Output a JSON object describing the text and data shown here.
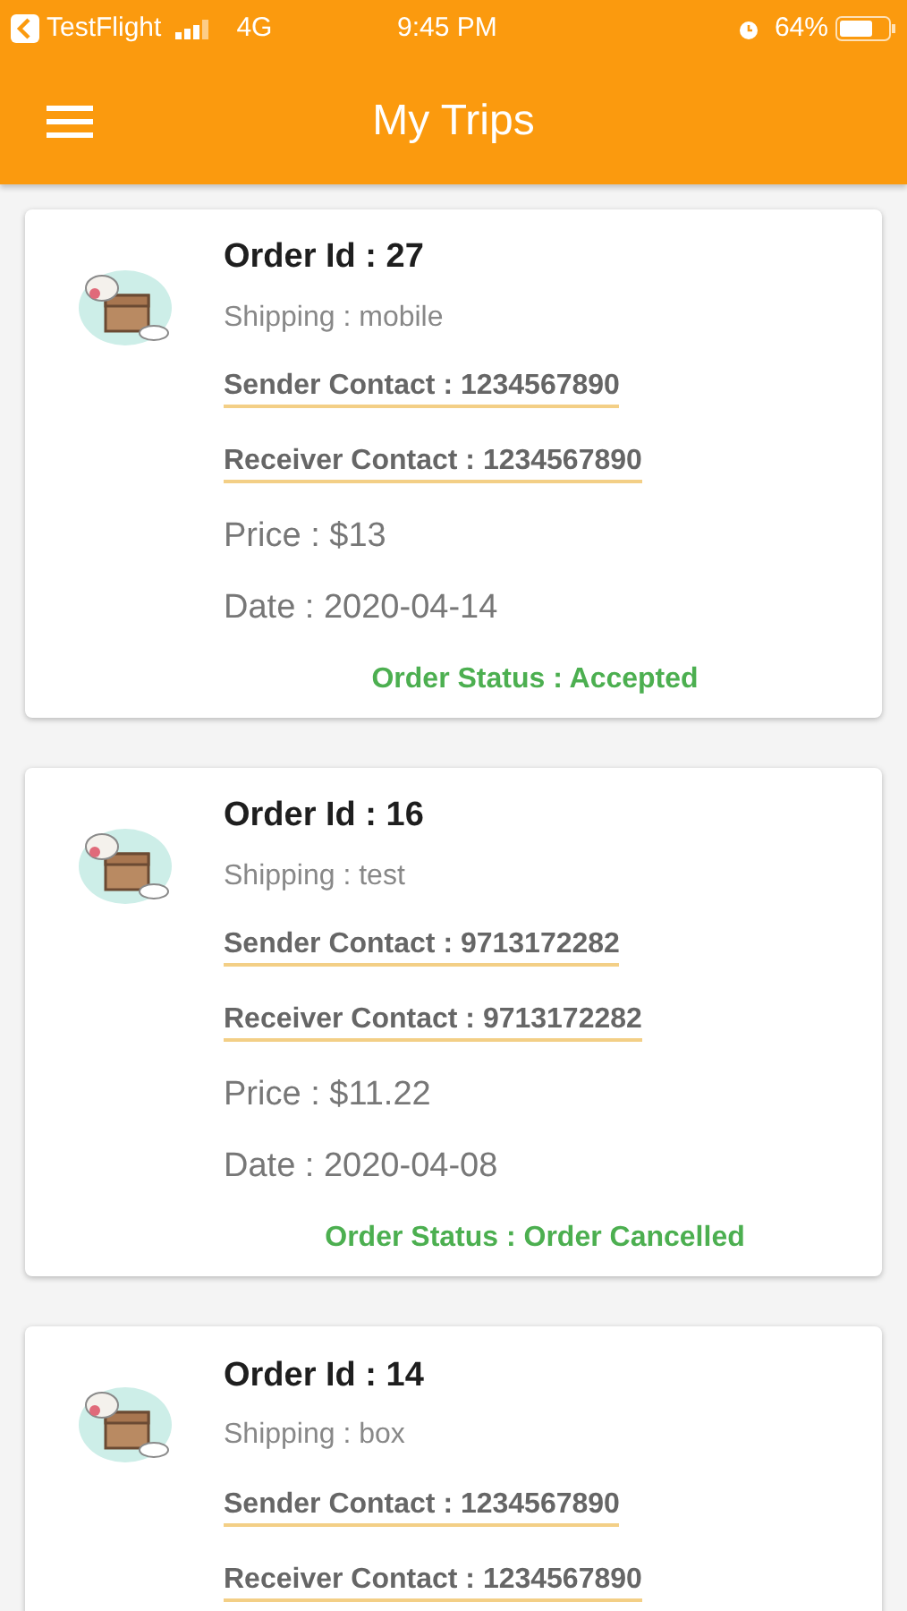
{
  "status_bar": {
    "back_app": "TestFlight",
    "network": "4G",
    "time": "9:45 PM",
    "battery": "64%"
  },
  "header": {
    "title": "My Trips"
  },
  "orders": [
    {
      "order_id": "Order Id : 27",
      "shipping": "Shipping : mobile",
      "sender": "Sender Contact : 1234567890",
      "receiver": "Receiver Contact : 1234567890",
      "price": "Price : $13",
      "date": "Date : 2020-04-14",
      "status": "Order Status : Accepted"
    },
    {
      "order_id": "Order Id : 16",
      "shipping": "Shipping : test",
      "sender": "Sender Contact : 9713172282",
      "receiver": "Receiver Contact : 9713172282",
      "price": "Price : $11.22",
      "date": "Date : 2020-04-08",
      "status": "Order Status : Order Cancelled"
    },
    {
      "order_id": "Order Id : 14",
      "shipping": "Shipping : box",
      "sender": "Sender Contact : 1234567890",
      "receiver": "Receiver Contact : 1234567890"
    }
  ]
}
